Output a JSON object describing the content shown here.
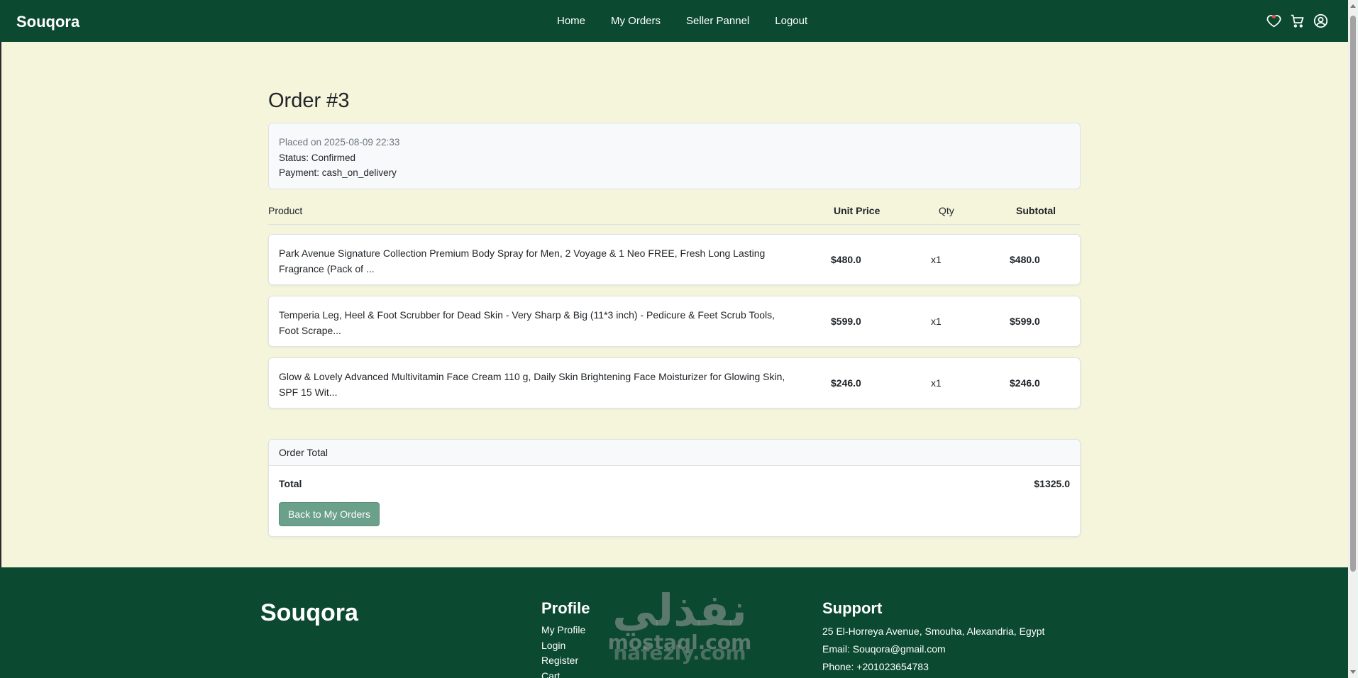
{
  "navbar": {
    "brand": "Souqora",
    "links": [
      "Home",
      "My Orders",
      "Seller Pannel",
      "Logout"
    ],
    "icons": [
      "heart-icon",
      "cart-icon",
      "user-icon"
    ]
  },
  "order": {
    "title": "Order #3",
    "placed_on": "Placed on 2025-08-09 22:33",
    "status": "Status: Confirmed",
    "payment": "Payment: cash_on_delivery"
  },
  "table": {
    "headers": {
      "product": "Product",
      "unit_price": "Unit Price",
      "qty": "Qty",
      "subtotal": "Subtotal"
    },
    "items": [
      {
        "name": "Park Avenue Signature Collection Premium Body Spray for Men, 2 Voyage & 1 Neo FREE, Fresh Long Lasting Fragrance (Pack of ...",
        "unit_price": "$480.0",
        "qty": "x1",
        "subtotal": "$480.0"
      },
      {
        "name": "Temperia Leg, Heel & Foot Scrubber for Dead Skin - Very Sharp & Big (11*3 inch) - Pedicure & Feet Scrub Tools, Foot Scrape...",
        "unit_price": "$599.0",
        "qty": "x1",
        "subtotal": "$599.0"
      },
      {
        "name": "Glow & Lovely Advanced Multivitamin Face Cream 110 g, Daily Skin Brightening Face Moisturizer for Glowing Skin, SPF 15 Wit...",
        "unit_price": "$246.0",
        "qty": "x1",
        "subtotal": "$246.0"
      }
    ]
  },
  "totals": {
    "header": "Order Total",
    "label": "Total",
    "amount": "$1325.0",
    "back_button": "Back to My Orders"
  },
  "footer": {
    "brand": "Souqora",
    "profile": {
      "title": "Profile",
      "links": [
        "My Profile",
        "Login",
        "Register",
        "Cart"
      ]
    },
    "support": {
      "title": "Support",
      "address": "25 El-Horreya Avenue, Smouha, Alexandria, Egypt",
      "email": "Email: Souqora@gmail.com",
      "phone": "Phone: +201023654783"
    }
  },
  "watermark": {
    "arabic": "نفذلي",
    "line1": "mostaql.com",
    "line2": "nafezly.com"
  },
  "colors": {
    "primary": "#0b4a30",
    "page_bg": "#f5f5dc",
    "button": "#6ba08a"
  }
}
